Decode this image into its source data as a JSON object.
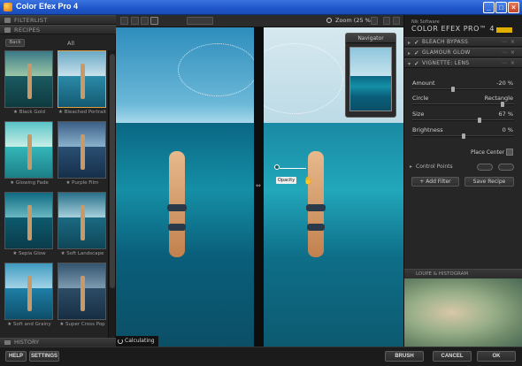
{
  "window": {
    "title": "Color Efex Pro 4",
    "min": "_",
    "max": "□",
    "close": "×"
  },
  "left_panel": {
    "filterlist_header": "FILTERLIST",
    "recipes_header": "RECIPES",
    "back_label": "Back",
    "all_label": "All",
    "recipes": [
      {
        "label": "★ Black Gold",
        "selected": false
      },
      {
        "label": "★ Bleached Portrait",
        "selected": true
      },
      {
        "label": "★ Glowing Fade",
        "selected": false
      },
      {
        "label": "★ Purple Film",
        "selected": false
      },
      {
        "label": "★ Sepia Glow",
        "selected": false
      },
      {
        "label": "★ Soft Landscape",
        "selected": false
      },
      {
        "label": "★ Soft and Grainy",
        "selected": false
      },
      {
        "label": "★ Super Cross Pop",
        "selected": false
      }
    ],
    "history_header": "HISTORY"
  },
  "toolbar": {
    "zoom_label": "Zoom (25 %)"
  },
  "preview": {
    "navigator_title": "Navigator",
    "opacity_label": "Opacity",
    "status": "Calculating"
  },
  "right_panel": {
    "brand_small": "Nik Software",
    "brand_big": "COLOR EFEX PRO™ 4",
    "filters": [
      {
        "name": "BLEACH BYPASS"
      },
      {
        "name": "GLAMOUR GLOW"
      },
      {
        "name": "VIGNETTE: LENS"
      }
    ],
    "params": {
      "amount_label": "Amount",
      "amount_value": "-20 %",
      "amount_level": 0.4,
      "circle_label": "Circle",
      "circle_value": "Rectangle",
      "circle_level": 0.9,
      "size_label": "Size",
      "size_value": "67 %",
      "size_level": 0.67,
      "brightness_label": "Brightness",
      "brightness_value": "0 %",
      "brightness_level": 0.5
    },
    "place_center_label": "Place Center",
    "control_points_label": "Control Points",
    "add_filter_label": "+ Add Filter",
    "save_recipe_label": "Save Recipe",
    "loupe_header": "LOUPE & HISTOGRAM"
  },
  "bottom": {
    "help": "HELP",
    "settings": "SETTINGS",
    "brush": "BRUSH",
    "cancel": "CANCEL",
    "ok": "OK"
  },
  "colors": {
    "titlebar": "#1f56c9",
    "selected_border": "#e0a040",
    "panel_bg": "#262626"
  }
}
